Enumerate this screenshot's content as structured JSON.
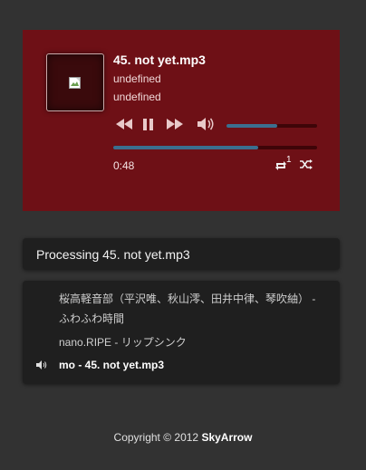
{
  "player": {
    "title": "45. not yet.mp3",
    "artist": "undefined",
    "album": "undefined",
    "current_time": "0:48",
    "progress_fraction": 0.71,
    "volume_fraction": 0.56,
    "repeat_count": "1",
    "cover_alt": "broken-image",
    "colors": {
      "panel": "#6e1016",
      "bar_fill": "#3b6f8f",
      "bar_track": "#3e0508"
    }
  },
  "status": {
    "text": "Processing 45. not yet.mp3"
  },
  "playlist": {
    "items": [
      {
        "label": "桜高軽音部（平沢唯、秋山澪、田井中律、琴吹紬） - ふわふわ時間"
      },
      {
        "label": "nano.RIPE - リップシンク"
      },
      {
        "label": "mo - 45. not yet.mp3",
        "playing": true
      }
    ]
  },
  "footer": {
    "prefix": "Copyright © 2012 ",
    "brand": "SkyArrow"
  }
}
